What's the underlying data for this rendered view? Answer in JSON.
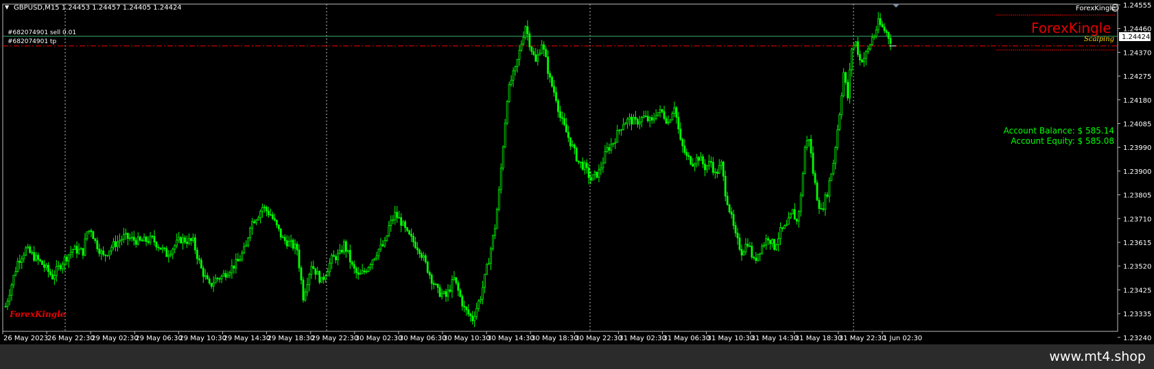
{
  "header": {
    "symbol_info": "GBPUSD,M15  1.24453 1.24457 1.24405 1.24424",
    "indicator_name": "ForexKingle"
  },
  "orders": {
    "sell_label": "#682074901 sell 0.01",
    "tp_label": "#682074901 tp"
  },
  "brand": {
    "main": "ForexKingle",
    "sub": "Scalping",
    "corner": "ForexKingle"
  },
  "account": {
    "balance": "Account Balance: $ 585.14",
    "equity": "Account Equity: $ 585.08"
  },
  "price_axis": {
    "ticks": [
      "1.24555",
      "1.24460",
      "1.24370",
      "1.24275",
      "1.24180",
      "1.24085",
      "1.23990",
      "1.23900",
      "1.23805",
      "1.23710",
      "1.23615",
      "1.23520",
      "1.23425",
      "1.23335",
      "1.23240"
    ],
    "current": "1.24424"
  },
  "time_axis": {
    "ticks": [
      "26 May 2023",
      "26 May 22:30",
      "29 May 02:30",
      "29 May 06:30",
      "29 May 10:30",
      "29 May 14:30",
      "29 May 18:30",
      "29 May 22:30",
      "30 May 02:30",
      "30 May 06:30",
      "30 May 10:30",
      "30 May 14:30",
      "30 May 18:30",
      "30 May 22:30",
      "31 May 02:30",
      "31 May 06:30",
      "31 May 10:30",
      "31 May 14:30",
      "31 May 18:30",
      "31 May 22:30",
      "1 Jun 02:30"
    ]
  },
  "footer": {
    "site": "www.mt4.shop"
  },
  "colors": {
    "background": "#000000",
    "candle": "#00ff00",
    "order_line": "#3cb371",
    "tp_line": "#ff0000",
    "brand": "#ff0000",
    "account_text": "#00ff00"
  },
  "chart_data": {
    "type": "candlestick",
    "symbol": "GBPUSD",
    "timeframe": "M15",
    "ylim": [
      1.2324,
      1.24555
    ],
    "close_path": [
      [
        0,
        1.2334
      ],
      [
        6,
        1.2352
      ],
      [
        10,
        1.2357
      ],
      [
        14,
        1.2354
      ],
      [
        18,
        1.2351
      ],
      [
        23,
        1.2346
      ],
      [
        28,
        1.2352
      ],
      [
        33,
        1.2357
      ],
      [
        38,
        1.2356
      ],
      [
        40,
        1.2364
      ],
      [
        42,
        1.2365
      ],
      [
        44,
        1.236
      ],
      [
        48,
        1.2354
      ],
      [
        52,
        1.2358
      ],
      [
        58,
        1.2362
      ],
      [
        66,
        1.236
      ],
      [
        72,
        1.2361
      ],
      [
        79,
        1.2355
      ],
      [
        86,
        1.2361
      ],
      [
        92,
        1.236
      ],
      [
        96,
        1.2349
      ],
      [
        100,
        1.2342
      ],
      [
        103,
        1.2345
      ],
      [
        106,
        1.2346
      ],
      [
        110,
        1.2349
      ],
      [
        114,
        1.2352
      ],
      [
        118,
        1.2358
      ],
      [
        120,
        1.2367
      ],
      [
        124,
        1.2371
      ],
      [
        126,
        1.2374
      ],
      [
        130,
        1.2371
      ],
      [
        133,
        1.2366
      ],
      [
        136,
        1.2361
      ],
      [
        140,
        1.2359
      ],
      [
        143,
        1.2357
      ],
      [
        146,
        1.2338
      ],
      [
        150,
        1.2351
      ],
      [
        155,
        1.2344
      ],
      [
        160,
        1.2353
      ],
      [
        164,
        1.2355
      ],
      [
        166,
        1.2359
      ],
      [
        168,
        1.2355
      ],
      [
        170,
        1.235
      ],
      [
        173,
        1.2346
      ],
      [
        176,
        1.2348
      ],
      [
        179,
        1.2352
      ],
      [
        183,
        1.2357
      ],
      [
        186,
        1.2359
      ],
      [
        188,
        1.2366
      ],
      [
        191,
        1.2371
      ],
      [
        194,
        1.2368
      ],
      [
        197,
        1.2363
      ],
      [
        200,
        1.236
      ],
      [
        203,
        1.2357
      ],
      [
        206,
        1.2351
      ],
      [
        209,
        1.2345
      ],
      [
        212,
        1.234
      ],
      [
        216,
        1.2338
      ],
      [
        220,
        1.2345
      ],
      [
        225,
        1.2333
      ],
      [
        229,
        1.2329
      ],
      [
        233,
        1.2338
      ],
      [
        237,
        1.2353
      ],
      [
        240,
        1.2366
      ],
      [
        242,
        1.238
      ],
      [
        244,
        1.2399
      ],
      [
        246,
        1.2418
      ],
      [
        248,
        1.2425
      ],
      [
        250,
        1.2429
      ],
      [
        253,
        1.244
      ],
      [
        255,
        1.2447
      ],
      [
        257,
        1.244
      ],
      [
        260,
        1.2432
      ],
      [
        263,
        1.244
      ],
      [
        265,
        1.2433
      ],
      [
        267,
        1.2425
      ],
      [
        270,
        1.2418
      ],
      [
        272,
        1.241
      ],
      [
        275,
        1.2404
      ],
      [
        278,
        1.2398
      ],
      [
        281,
        1.2392
      ],
      [
        284,
        1.239
      ],
      [
        287,
        1.2385
      ],
      [
        291,
        1.2388
      ],
      [
        295,
        1.2397
      ],
      [
        298,
        1.24
      ],
      [
        301,
        1.2405
      ],
      [
        303,
        1.2408
      ],
      [
        306,
        1.2409
      ],
      [
        309,
        1.2408
      ],
      [
        313,
        1.241
      ],
      [
        317,
        1.2408
      ],
      [
        319,
        1.2412
      ],
      [
        322,
        1.2412
      ],
      [
        325,
        1.2408
      ],
      [
        328,
        1.2415
      ],
      [
        331,
        1.24
      ],
      [
        334,
        1.2394
      ],
      [
        337,
        1.2392
      ],
      [
        340,
        1.2394
      ],
      [
        343,
        1.239
      ],
      [
        346,
        1.2392
      ],
      [
        348,
        1.2387
      ],
      [
        351,
        1.2391
      ],
      [
        353,
        1.238
      ],
      [
        355,
        1.2373
      ],
      [
        358,
        1.2362
      ],
      [
        361,
        1.2356
      ],
      [
        364,
        1.236
      ],
      [
        367,
        1.2352
      ],
      [
        370,
        1.2357
      ],
      [
        374,
        1.2362
      ],
      [
        377,
        1.2358
      ],
      [
        380,
        1.2364
      ],
      [
        383,
        1.2366
      ],
      [
        386,
        1.2372
      ],
      [
        388,
        1.2368
      ],
      [
        390,
        1.2378
      ],
      [
        392,
        1.2398
      ],
      [
        394,
        1.2402
      ],
      [
        396,
        1.2388
      ],
      [
        398,
        1.2378
      ],
      [
        400,
        1.2372
      ],
      [
        403,
        1.238
      ],
      [
        406,
        1.2392
      ],
      [
        409,
        1.2412
      ],
      [
        411,
        1.2428
      ],
      [
        413,
        1.2418
      ],
      [
        415,
        1.2438
      ],
      [
        417,
        1.244
      ],
      [
        419,
        1.2433
      ],
      [
        421,
        1.2434
      ],
      [
        423,
        1.2437
      ],
      [
        425,
        1.2442
      ],
      [
        426,
        1.2443
      ],
      [
        428,
        1.2448
      ],
      [
        430,
        1.2446
      ],
      [
        432,
        1.2444
      ],
      [
        434,
        1.2441
      ]
    ]
  }
}
